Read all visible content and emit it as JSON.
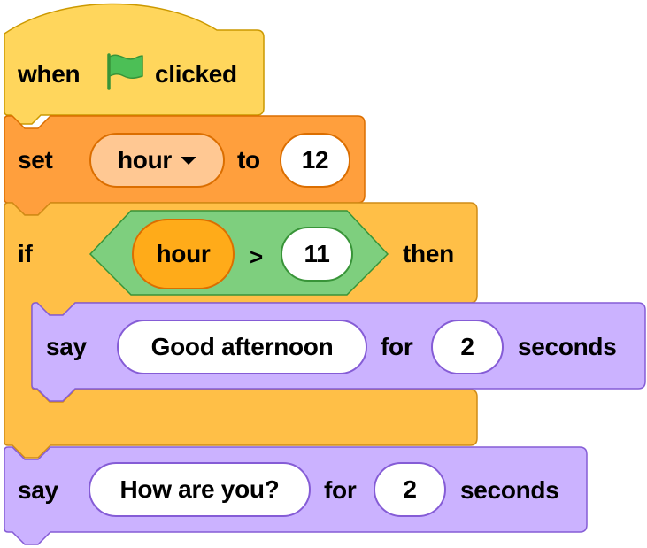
{
  "colors": {
    "events": "#ffd65c",
    "events_border": "#cc9900",
    "variables": "#ff9f3d",
    "variables_border": "#db6e00",
    "variable_dropdown": "#ffc893",
    "control": "#ffbf47",
    "control_border": "#cf8b17",
    "operators": "#7ecf7e",
    "operators_border": "#389438",
    "looks": "#cbb2ff",
    "looks_border": "#855cd6"
  },
  "script": {
    "hat": {
      "label_when": "when",
      "icon": "green-flag-icon",
      "label_clicked": "clicked"
    },
    "set_block": {
      "label_set": "set",
      "variable": "hour",
      "label_to": "to",
      "value": "12"
    },
    "if_block": {
      "label_if": "if",
      "condition": {
        "left": "hour",
        "operator": ">",
        "right": "11"
      },
      "label_then": "then",
      "inner_say": {
        "label_say": "say",
        "message": "Good afternoon",
        "label_for": "for",
        "secs": "2",
        "label_seconds": "seconds"
      }
    },
    "final_say": {
      "label_say": "say",
      "message": "How are you?",
      "label_for": "for",
      "secs": "2",
      "label_seconds": "seconds"
    }
  }
}
